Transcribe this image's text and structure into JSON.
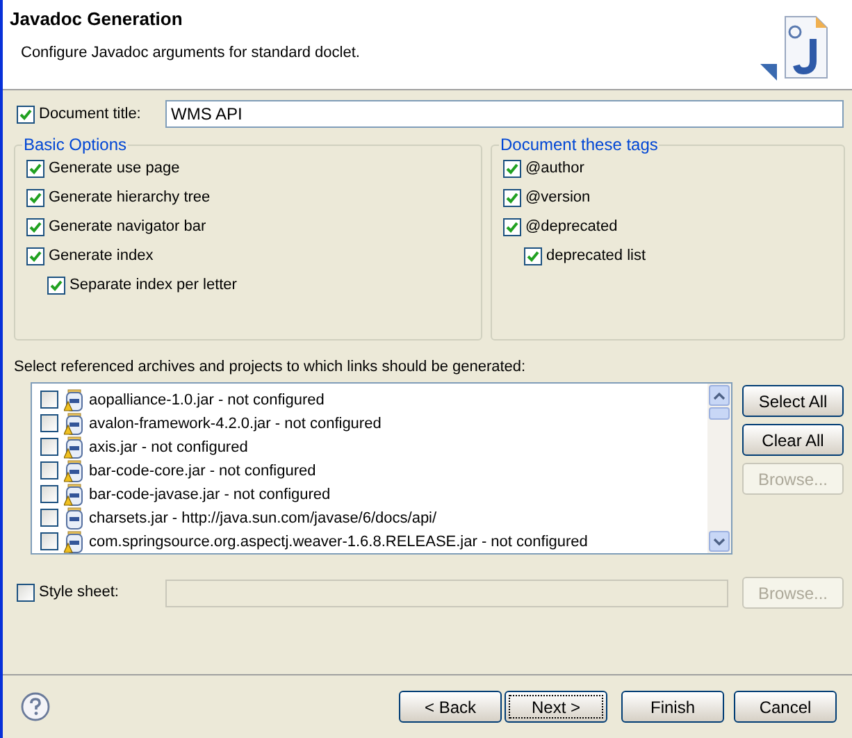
{
  "header": {
    "title": "Javadoc Generation",
    "description": "Configure Javadoc arguments for standard doclet."
  },
  "document_title": {
    "label": "Document title:",
    "checked": true,
    "value": "WMS API"
  },
  "basic_options": {
    "title": "Basic Options",
    "items": [
      {
        "label": "Generate use page",
        "checked": true
      },
      {
        "label": "Generate hierarchy tree",
        "checked": true
      },
      {
        "label": "Generate navigator bar",
        "checked": true
      },
      {
        "label": "Generate index",
        "checked": true,
        "children": [
          {
            "label": "Separate index per letter",
            "checked": true
          }
        ]
      }
    ]
  },
  "tags": {
    "title": "Document these tags",
    "items": [
      {
        "label": "@author",
        "checked": true
      },
      {
        "label": "@version",
        "checked": true
      },
      {
        "label": "@deprecated",
        "checked": true,
        "children": [
          {
            "label": "deprecated list",
            "checked": true
          }
        ]
      }
    ]
  },
  "links": {
    "label": "Select referenced archives and projects to which links should be generated:",
    "items": [
      {
        "label": "aopalliance-1.0.jar - not configured",
        "checked": false,
        "warning": true
      },
      {
        "label": "avalon-framework-4.2.0.jar - not configured",
        "checked": false,
        "warning": true
      },
      {
        "label": "axis.jar - not configured",
        "checked": false,
        "warning": true
      },
      {
        "label": "bar-code-core.jar - not configured",
        "checked": false,
        "warning": true
      },
      {
        "label": "bar-code-javase.jar - not configured",
        "checked": false,
        "warning": true
      },
      {
        "label": "charsets.jar - http://java.sun.com/javase/6/docs/api/",
        "checked": false,
        "warning": false
      },
      {
        "label": "com.springsource.org.aspectj.weaver-1.6.8.RELEASE.jar - not configured",
        "checked": false,
        "warning": true
      }
    ],
    "buttons": [
      {
        "label": "Select All",
        "disabled": false
      },
      {
        "label": "Clear All",
        "disabled": false
      },
      {
        "label": "Browse...",
        "disabled": true
      }
    ]
  },
  "style_sheet": {
    "label": "Style sheet:",
    "checked": false,
    "disabled": true,
    "button": {
      "label": "Browse...",
      "disabled": true
    }
  },
  "footer_buttons": [
    {
      "label": "< Back",
      "disabled": false,
      "focused": false
    },
    {
      "label": "Next >",
      "disabled": false,
      "focused": true
    },
    {
      "label": "Finish",
      "disabled": false,
      "focused": false
    },
    {
      "label": "Cancel",
      "disabled": false,
      "focused": false
    }
  ]
}
